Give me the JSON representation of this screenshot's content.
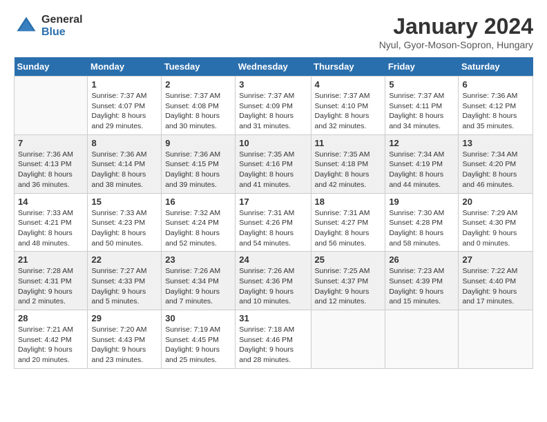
{
  "header": {
    "logo_general": "General",
    "logo_blue": "Blue",
    "month_title": "January 2024",
    "location": "Nyul, Gyor-Moson-Sopron, Hungary"
  },
  "calendar": {
    "days_of_week": [
      "Sunday",
      "Monday",
      "Tuesday",
      "Wednesday",
      "Thursday",
      "Friday",
      "Saturday"
    ],
    "weeks": [
      [
        {
          "day": "",
          "info": ""
        },
        {
          "day": "1",
          "info": "Sunrise: 7:37 AM\nSunset: 4:07 PM\nDaylight: 8 hours\nand 29 minutes."
        },
        {
          "day": "2",
          "info": "Sunrise: 7:37 AM\nSunset: 4:08 PM\nDaylight: 8 hours\nand 30 minutes."
        },
        {
          "day": "3",
          "info": "Sunrise: 7:37 AM\nSunset: 4:09 PM\nDaylight: 8 hours\nand 31 minutes."
        },
        {
          "day": "4",
          "info": "Sunrise: 7:37 AM\nSunset: 4:10 PM\nDaylight: 8 hours\nand 32 minutes."
        },
        {
          "day": "5",
          "info": "Sunrise: 7:37 AM\nSunset: 4:11 PM\nDaylight: 8 hours\nand 34 minutes."
        },
        {
          "day": "6",
          "info": "Sunrise: 7:36 AM\nSunset: 4:12 PM\nDaylight: 8 hours\nand 35 minutes."
        }
      ],
      [
        {
          "day": "7",
          "info": "Sunrise: 7:36 AM\nSunset: 4:13 PM\nDaylight: 8 hours\nand 36 minutes."
        },
        {
          "day": "8",
          "info": "Sunrise: 7:36 AM\nSunset: 4:14 PM\nDaylight: 8 hours\nand 38 minutes."
        },
        {
          "day": "9",
          "info": "Sunrise: 7:36 AM\nSunset: 4:15 PM\nDaylight: 8 hours\nand 39 minutes."
        },
        {
          "day": "10",
          "info": "Sunrise: 7:35 AM\nSunset: 4:16 PM\nDaylight: 8 hours\nand 41 minutes."
        },
        {
          "day": "11",
          "info": "Sunrise: 7:35 AM\nSunset: 4:18 PM\nDaylight: 8 hours\nand 42 minutes."
        },
        {
          "day": "12",
          "info": "Sunrise: 7:34 AM\nSunset: 4:19 PM\nDaylight: 8 hours\nand 44 minutes."
        },
        {
          "day": "13",
          "info": "Sunrise: 7:34 AM\nSunset: 4:20 PM\nDaylight: 8 hours\nand 46 minutes."
        }
      ],
      [
        {
          "day": "14",
          "info": "Sunrise: 7:33 AM\nSunset: 4:21 PM\nDaylight: 8 hours\nand 48 minutes."
        },
        {
          "day": "15",
          "info": "Sunrise: 7:33 AM\nSunset: 4:23 PM\nDaylight: 8 hours\nand 50 minutes."
        },
        {
          "day": "16",
          "info": "Sunrise: 7:32 AM\nSunset: 4:24 PM\nDaylight: 8 hours\nand 52 minutes."
        },
        {
          "day": "17",
          "info": "Sunrise: 7:31 AM\nSunset: 4:26 PM\nDaylight: 8 hours\nand 54 minutes."
        },
        {
          "day": "18",
          "info": "Sunrise: 7:31 AM\nSunset: 4:27 PM\nDaylight: 8 hours\nand 56 minutes."
        },
        {
          "day": "19",
          "info": "Sunrise: 7:30 AM\nSunset: 4:28 PM\nDaylight: 8 hours\nand 58 minutes."
        },
        {
          "day": "20",
          "info": "Sunrise: 7:29 AM\nSunset: 4:30 PM\nDaylight: 9 hours\nand 0 minutes."
        }
      ],
      [
        {
          "day": "21",
          "info": "Sunrise: 7:28 AM\nSunset: 4:31 PM\nDaylight: 9 hours\nand 2 minutes."
        },
        {
          "day": "22",
          "info": "Sunrise: 7:27 AM\nSunset: 4:33 PM\nDaylight: 9 hours\nand 5 minutes."
        },
        {
          "day": "23",
          "info": "Sunrise: 7:26 AM\nSunset: 4:34 PM\nDaylight: 9 hours\nand 7 minutes."
        },
        {
          "day": "24",
          "info": "Sunrise: 7:26 AM\nSunset: 4:36 PM\nDaylight: 9 hours\nand 10 minutes."
        },
        {
          "day": "25",
          "info": "Sunrise: 7:25 AM\nSunset: 4:37 PM\nDaylight: 9 hours\nand 12 minutes."
        },
        {
          "day": "26",
          "info": "Sunrise: 7:23 AM\nSunset: 4:39 PM\nDaylight: 9 hours\nand 15 minutes."
        },
        {
          "day": "27",
          "info": "Sunrise: 7:22 AM\nSunset: 4:40 PM\nDaylight: 9 hours\nand 17 minutes."
        }
      ],
      [
        {
          "day": "28",
          "info": "Sunrise: 7:21 AM\nSunset: 4:42 PM\nDaylight: 9 hours\nand 20 minutes."
        },
        {
          "day": "29",
          "info": "Sunrise: 7:20 AM\nSunset: 4:43 PM\nDaylight: 9 hours\nand 23 minutes."
        },
        {
          "day": "30",
          "info": "Sunrise: 7:19 AM\nSunset: 4:45 PM\nDaylight: 9 hours\nand 25 minutes."
        },
        {
          "day": "31",
          "info": "Sunrise: 7:18 AM\nSunset: 4:46 PM\nDaylight: 9 hours\nand 28 minutes."
        },
        {
          "day": "",
          "info": ""
        },
        {
          "day": "",
          "info": ""
        },
        {
          "day": "",
          "info": ""
        }
      ]
    ]
  }
}
